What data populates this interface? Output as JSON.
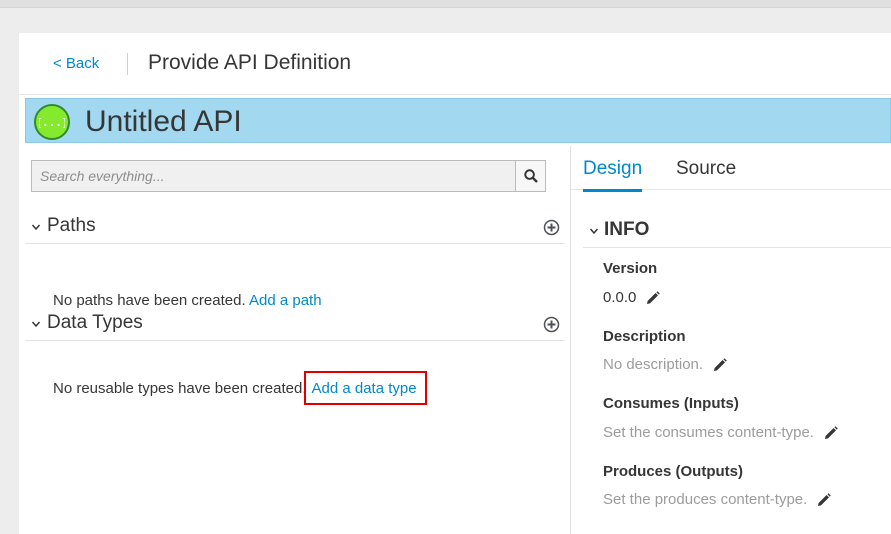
{
  "header": {
    "back_label": "< Back",
    "title": "Provide API Definition"
  },
  "api": {
    "name": "Untitled API",
    "logo_icon": "swagger-logo-icon",
    "logo_text": "{...}"
  },
  "search": {
    "placeholder": "Search everything..."
  },
  "paths": {
    "title": "Paths",
    "empty_message": "No paths have been created.",
    "add_link": "Add a path"
  },
  "data_types": {
    "title": "Data Types",
    "empty_message": "No reusable types have been created.",
    "add_link": "Add a data type"
  },
  "tabs": [
    {
      "label": "Design",
      "active": true
    },
    {
      "label": "Source",
      "active": false
    }
  ],
  "info": {
    "title": "INFO",
    "version_label": "Version",
    "version_value": "0.0.0",
    "description_label": "Description",
    "description_value": "No description.",
    "consumes_label": "Consumes (Inputs)",
    "consumes_value": "Set the consumes content-type.",
    "produces_label": "Produces (Outputs)",
    "produces_value": "Set the produces content-type."
  },
  "colors": {
    "accent": "#0088ce",
    "api_bar": "#a2d9f0",
    "highlight": "#e00000"
  }
}
